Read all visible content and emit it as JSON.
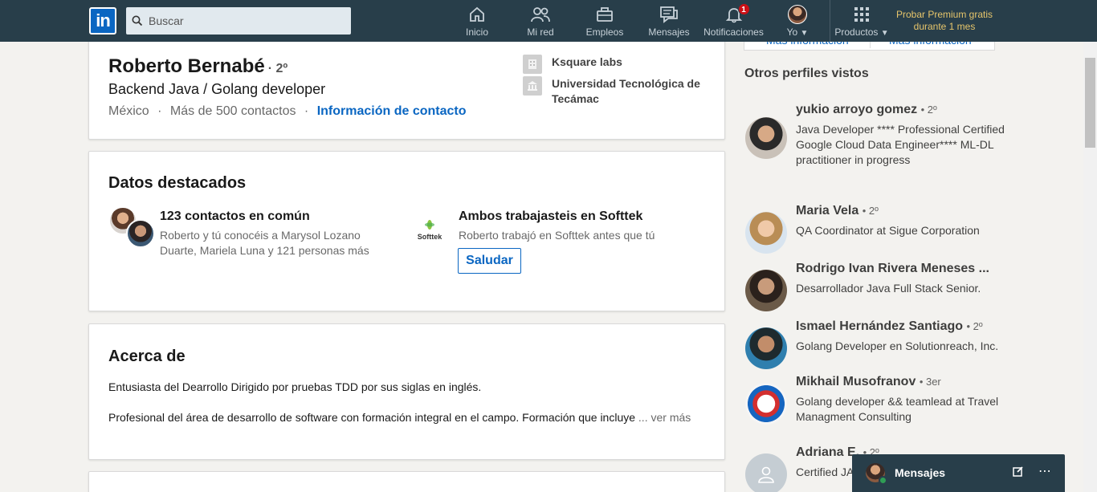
{
  "topbar": {
    "logo": "in",
    "search_placeholder": "Buscar",
    "nav": [
      {
        "label": "Inicio",
        "icon": "home-icon"
      },
      {
        "label": "Mi red",
        "icon": "network-icon"
      },
      {
        "label": "Empleos",
        "icon": "briefcase-icon"
      },
      {
        "label": "Mensajes",
        "icon": "messages-icon"
      },
      {
        "label": "Notificaciones",
        "icon": "bell-icon",
        "badge": "1"
      },
      {
        "label": "Yo",
        "icon": "avatar"
      },
      {
        "label": "Productos",
        "icon": "grid-icon"
      }
    ],
    "premium": "Probar Premium gratis durante 1 mes"
  },
  "profile": {
    "name": "Roberto Bernabé",
    "degree": "· 2º",
    "headline": "Backend Java / Golang developer",
    "location": "México",
    "sep": "·",
    "connections": "Más de 500 contactos",
    "contact_info": "Información de contacto",
    "company": "Ksquare labs",
    "school": "Universidad Tecnológica de Tecámac"
  },
  "highlights": {
    "title": "Datos destacados",
    "mutual_title": "123 contactos en común",
    "mutual_desc": "Roberto y tú conocéis a Marysol Lozano Duarte, Mariela Luna y 121 personas más",
    "company_logo": "Softtek",
    "company_title": "Ambos trabajasteis en Softtek",
    "company_desc": "Roberto trabajó en Softtek antes que tú",
    "button": "Saludar"
  },
  "about": {
    "title": "Acerca de",
    "p1": "Entusiasta del Dearrollo Dirigido por pruebas TDD por sus siglas en inglés.",
    "p2": "Profesional del área de desarrollo de software con formación integral en el campo. Formación que incluye",
    "more": "... ver más"
  },
  "sidebar": {
    "contact_links": [
      "Más información",
      "Más información"
    ],
    "title": "Otros perfiles vistos",
    "people": [
      {
        "name": "yukio arroyo gomez",
        "degree": "• 2º",
        "desc": "Java Developer **** Professional Certified Google Cloud Data Engineer**** ML-DL practitioner in progress"
      },
      {
        "name": "Maria Vela",
        "degree": "• 2º",
        "desc": "QA Coordinator at Sigue Corporation"
      },
      {
        "name": "Rodrigo Ivan Rivera Meneses ...",
        "degree": "",
        "desc": "Desarrollador Java Full Stack Senior."
      },
      {
        "name": "Ismael Hernández Santiago",
        "degree": "• 2º",
        "desc": "Golang Developer en Solutionreach, Inc."
      },
      {
        "name": "Mikhail Musofranov",
        "degree": "• 3er",
        "desc": "Golang developer && teamlead at Travel Managment Consulting"
      },
      {
        "name": "Adriana E.",
        "degree": "• 2º",
        "desc": "Certified JAVA"
      }
    ]
  },
  "messaging": {
    "title": "Mensajes"
  },
  "colors": {
    "nav_bg": "#283e4a",
    "link": "#0a66c2",
    "premium": "#e6c56b",
    "badge": "#cc1016"
  }
}
